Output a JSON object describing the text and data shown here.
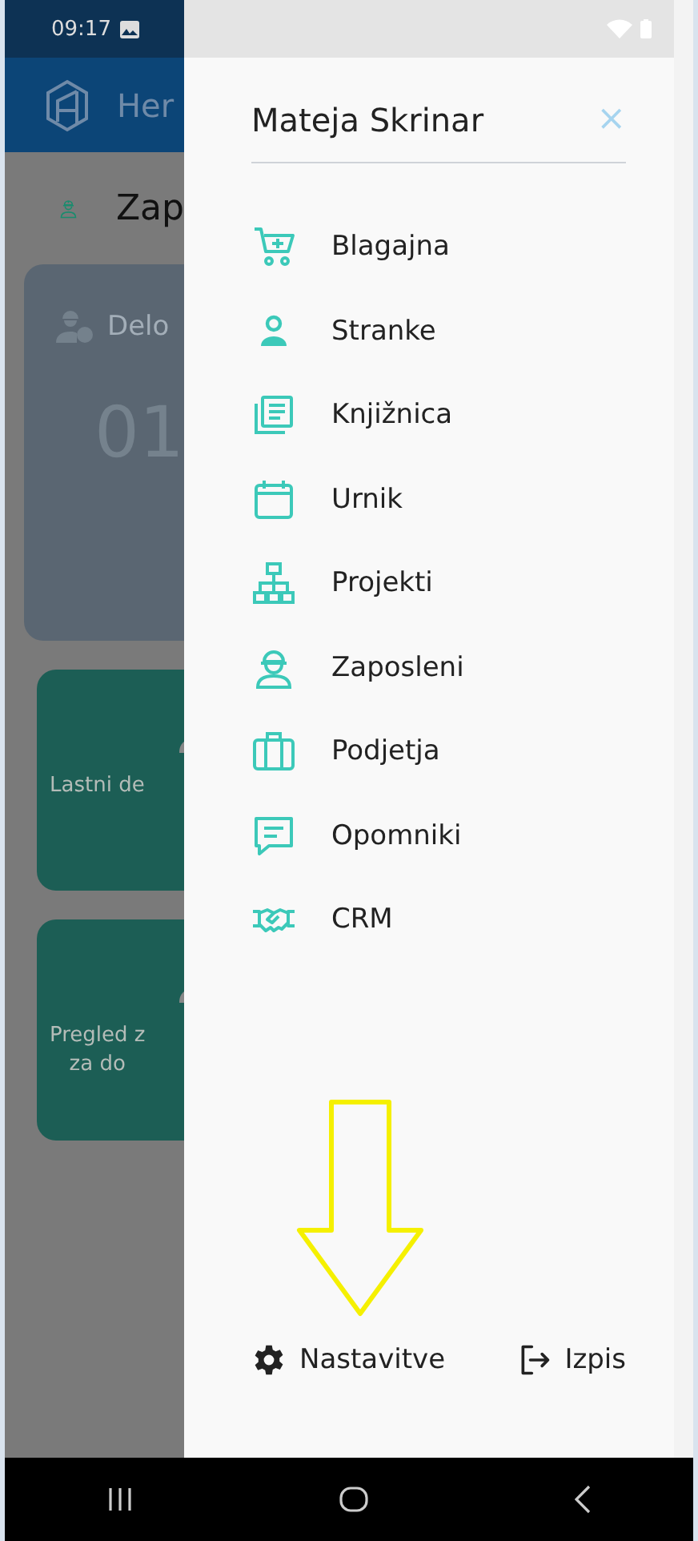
{
  "status_bar": {
    "time": "09:17"
  },
  "background_app": {
    "header_title": "Her",
    "section_title": "Zap",
    "cards": [
      {
        "kind": "stat",
        "lines": [
          "Delo"
        ],
        "value": "01"
      },
      {
        "kind": "action",
        "lines": [
          "Lastni de"
        ]
      },
      {
        "kind": "action",
        "lines": [
          "Pregled z",
          "za do"
        ]
      }
    ]
  },
  "drawer": {
    "user_name": "Mateja Skrinar",
    "close_label": "×",
    "items": [
      {
        "kind": "cart",
        "label": "Blagajna"
      },
      {
        "kind": "person",
        "label": "Stranke"
      },
      {
        "kind": "library",
        "label": "Knjižnica"
      },
      {
        "kind": "calendar",
        "label": "Urnik"
      },
      {
        "kind": "hierarchy",
        "label": "Projekti"
      },
      {
        "kind": "worker",
        "label": "Zaposleni"
      },
      {
        "kind": "briefcase",
        "label": "Podjetja"
      },
      {
        "kind": "message",
        "label": "Opomniki"
      },
      {
        "kind": "handshake",
        "label": "CRM"
      }
    ],
    "footer": [
      {
        "kind": "settings",
        "label": "Nastavitve"
      },
      {
        "kind": "logout",
        "label": "Izpis"
      }
    ]
  }
}
